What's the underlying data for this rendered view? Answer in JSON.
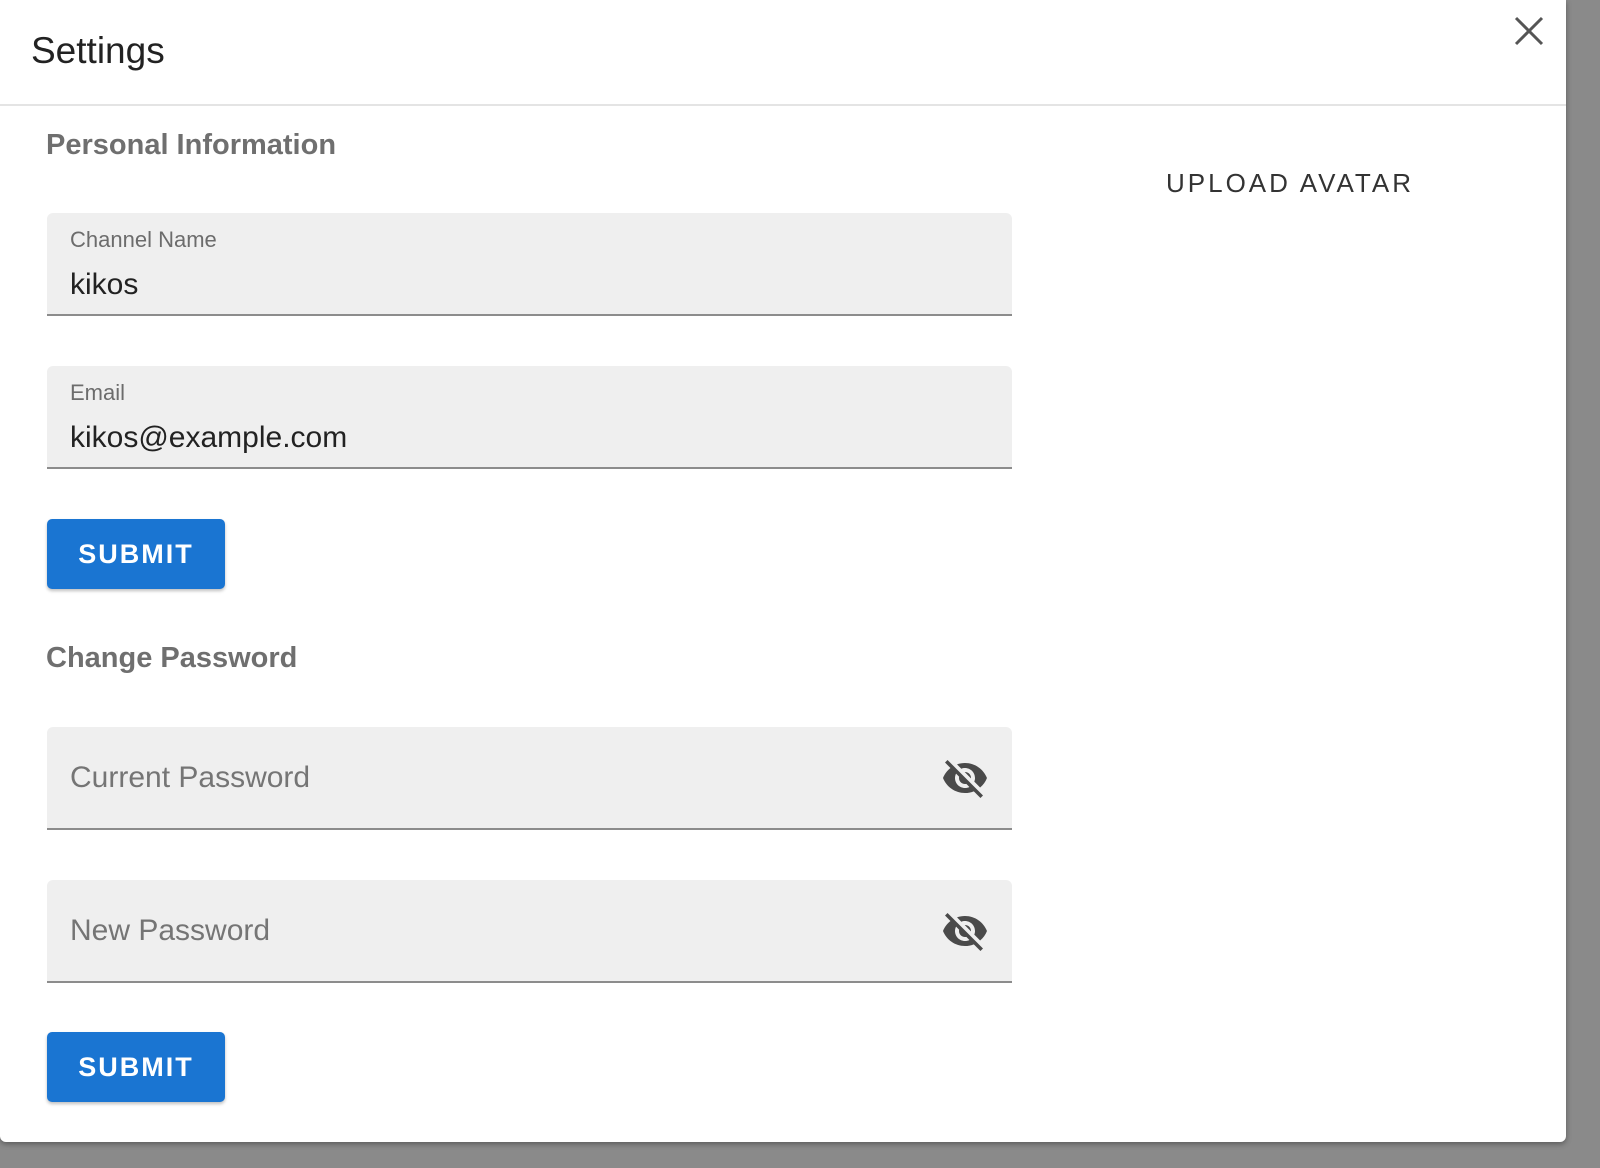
{
  "dialog": {
    "title": "Settings"
  },
  "personal_info": {
    "heading": "Personal Information",
    "channel_name": {
      "label": "Channel Name",
      "value": "kikos"
    },
    "email": {
      "label": "Email",
      "value": "kikos@example.com"
    },
    "submit_label": "SUBMIT"
  },
  "avatar": {
    "upload_label": "UPLOAD AVATAR"
  },
  "change_password": {
    "heading": "Change Password",
    "current_password": {
      "placeholder": "Current Password",
      "icon": "visibility-off-icon"
    },
    "new_password": {
      "placeholder": "New Password",
      "icon": "visibility-off-icon"
    },
    "submit_label": "SUBMIT"
  },
  "colors": {
    "primary": "#1a75d2",
    "field_background": "#efefef",
    "heading_text": "#6f6f6f"
  }
}
